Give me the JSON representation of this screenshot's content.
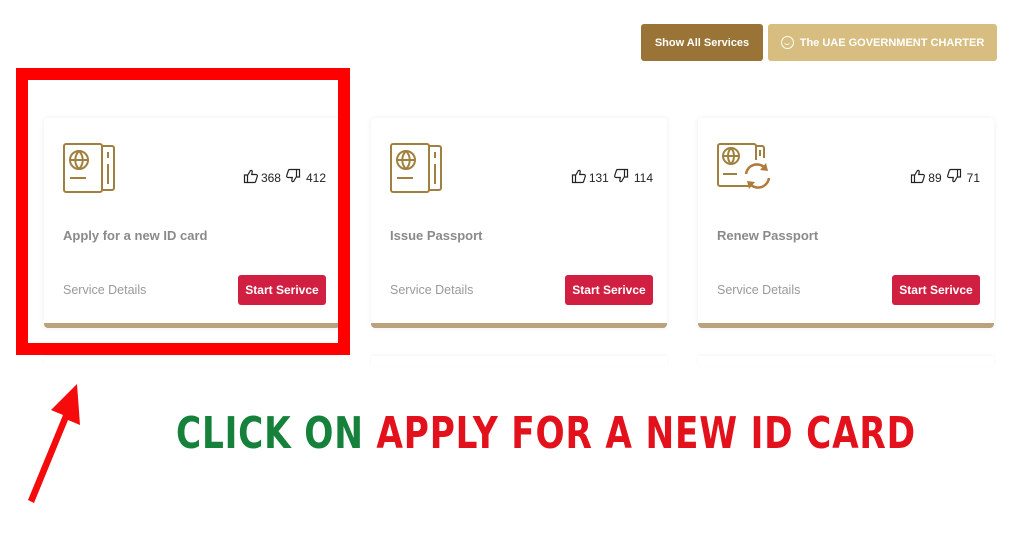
{
  "header": {
    "show_all_label": "Show All Services",
    "charter_label": "The UAE GOVERNMENT CHARTER",
    "charter_icon": "smile-icon"
  },
  "colors": {
    "brand_gold_dark": "#9a7436",
    "brand_gold_light": "#d8bd80",
    "start_button": "#d11f42",
    "highlight_red": "#ff0000",
    "instruction_green": "#15813b",
    "instruction_red": "#e3111b"
  },
  "services": [
    {
      "title": "Apply for a new ID card",
      "icon": "passport-icon",
      "likes": "368",
      "dislikes": "412",
      "details_label": "Service Details",
      "start_label": "Start Serivce",
      "highlighted": true
    },
    {
      "title": "Issue Passport",
      "icon": "passport-icon",
      "likes": "131",
      "dislikes": "114",
      "details_label": "Service Details",
      "start_label": "Start Serivce",
      "highlighted": false
    },
    {
      "title": "Renew Passport",
      "icon": "renew-passport-icon",
      "likes": "89",
      "dislikes": "71",
      "details_label": "Service Details",
      "start_label": "Start Serivce",
      "highlighted": false
    }
  ],
  "instruction": {
    "part1": "CLICK ON ",
    "part2": "APPLY FOR A NEW ID CARD"
  }
}
